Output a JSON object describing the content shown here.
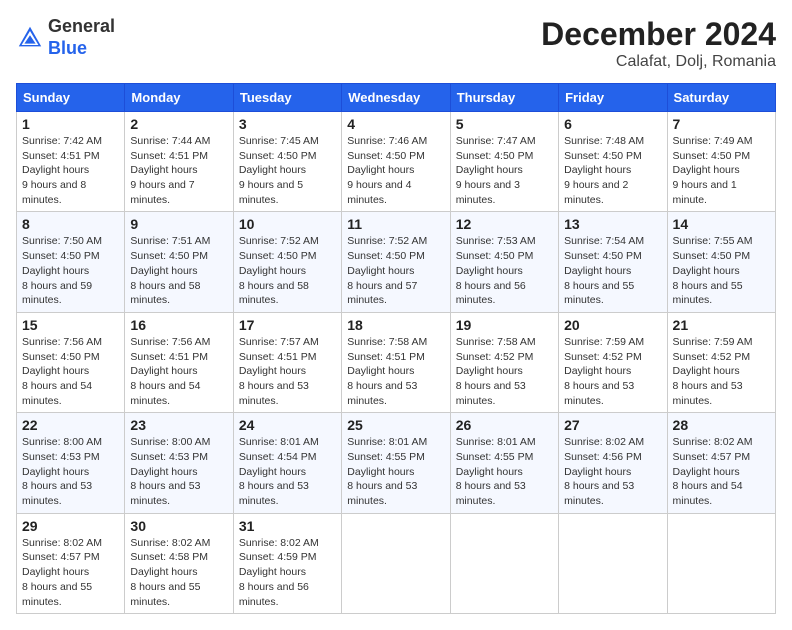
{
  "header": {
    "logo_general": "General",
    "logo_blue": "Blue",
    "month_title": "December 2024",
    "location": "Calafat, Dolj, Romania"
  },
  "days_of_week": [
    "Sunday",
    "Monday",
    "Tuesday",
    "Wednesday",
    "Thursday",
    "Friday",
    "Saturday"
  ],
  "weeks": [
    [
      {
        "day": 1,
        "sunrise": "7:42 AM",
        "sunset": "4:51 PM",
        "daylight": "9 hours and 8 minutes."
      },
      {
        "day": 2,
        "sunrise": "7:44 AM",
        "sunset": "4:51 PM",
        "daylight": "9 hours and 7 minutes."
      },
      {
        "day": 3,
        "sunrise": "7:45 AM",
        "sunset": "4:50 PM",
        "daylight": "9 hours and 5 minutes."
      },
      {
        "day": 4,
        "sunrise": "7:46 AM",
        "sunset": "4:50 PM",
        "daylight": "9 hours and 4 minutes."
      },
      {
        "day": 5,
        "sunrise": "7:47 AM",
        "sunset": "4:50 PM",
        "daylight": "9 hours and 3 minutes."
      },
      {
        "day": 6,
        "sunrise": "7:48 AM",
        "sunset": "4:50 PM",
        "daylight": "9 hours and 2 minutes."
      },
      {
        "day": 7,
        "sunrise": "7:49 AM",
        "sunset": "4:50 PM",
        "daylight": "9 hours and 1 minute."
      }
    ],
    [
      {
        "day": 8,
        "sunrise": "7:50 AM",
        "sunset": "4:50 PM",
        "daylight": "8 hours and 59 minutes."
      },
      {
        "day": 9,
        "sunrise": "7:51 AM",
        "sunset": "4:50 PM",
        "daylight": "8 hours and 58 minutes."
      },
      {
        "day": 10,
        "sunrise": "7:52 AM",
        "sunset": "4:50 PM",
        "daylight": "8 hours and 58 minutes."
      },
      {
        "day": 11,
        "sunrise": "7:52 AM",
        "sunset": "4:50 PM",
        "daylight": "8 hours and 57 minutes."
      },
      {
        "day": 12,
        "sunrise": "7:53 AM",
        "sunset": "4:50 PM",
        "daylight": "8 hours and 56 minutes."
      },
      {
        "day": 13,
        "sunrise": "7:54 AM",
        "sunset": "4:50 PM",
        "daylight": "8 hours and 55 minutes."
      },
      {
        "day": 14,
        "sunrise": "7:55 AM",
        "sunset": "4:50 PM",
        "daylight": "8 hours and 55 minutes."
      }
    ],
    [
      {
        "day": 15,
        "sunrise": "7:56 AM",
        "sunset": "4:50 PM",
        "daylight": "8 hours and 54 minutes."
      },
      {
        "day": 16,
        "sunrise": "7:56 AM",
        "sunset": "4:51 PM",
        "daylight": "8 hours and 54 minutes."
      },
      {
        "day": 17,
        "sunrise": "7:57 AM",
        "sunset": "4:51 PM",
        "daylight": "8 hours and 53 minutes."
      },
      {
        "day": 18,
        "sunrise": "7:58 AM",
        "sunset": "4:51 PM",
        "daylight": "8 hours and 53 minutes."
      },
      {
        "day": 19,
        "sunrise": "7:58 AM",
        "sunset": "4:52 PM",
        "daylight": "8 hours and 53 minutes."
      },
      {
        "day": 20,
        "sunrise": "7:59 AM",
        "sunset": "4:52 PM",
        "daylight": "8 hours and 53 minutes."
      },
      {
        "day": 21,
        "sunrise": "7:59 AM",
        "sunset": "4:52 PM",
        "daylight": "8 hours and 53 minutes."
      }
    ],
    [
      {
        "day": 22,
        "sunrise": "8:00 AM",
        "sunset": "4:53 PM",
        "daylight": "8 hours and 53 minutes."
      },
      {
        "day": 23,
        "sunrise": "8:00 AM",
        "sunset": "4:53 PM",
        "daylight": "8 hours and 53 minutes."
      },
      {
        "day": 24,
        "sunrise": "8:01 AM",
        "sunset": "4:54 PM",
        "daylight": "8 hours and 53 minutes."
      },
      {
        "day": 25,
        "sunrise": "8:01 AM",
        "sunset": "4:55 PM",
        "daylight": "8 hours and 53 minutes."
      },
      {
        "day": 26,
        "sunrise": "8:01 AM",
        "sunset": "4:55 PM",
        "daylight": "8 hours and 53 minutes."
      },
      {
        "day": 27,
        "sunrise": "8:02 AM",
        "sunset": "4:56 PM",
        "daylight": "8 hours and 53 minutes."
      },
      {
        "day": 28,
        "sunrise": "8:02 AM",
        "sunset": "4:57 PM",
        "daylight": "8 hours and 54 minutes."
      }
    ],
    [
      {
        "day": 29,
        "sunrise": "8:02 AM",
        "sunset": "4:57 PM",
        "daylight": "8 hours and 55 minutes."
      },
      {
        "day": 30,
        "sunrise": "8:02 AM",
        "sunset": "4:58 PM",
        "daylight": "8 hours and 55 minutes."
      },
      {
        "day": 31,
        "sunrise": "8:02 AM",
        "sunset": "4:59 PM",
        "daylight": "8 hours and 56 minutes."
      },
      null,
      null,
      null,
      null
    ]
  ]
}
